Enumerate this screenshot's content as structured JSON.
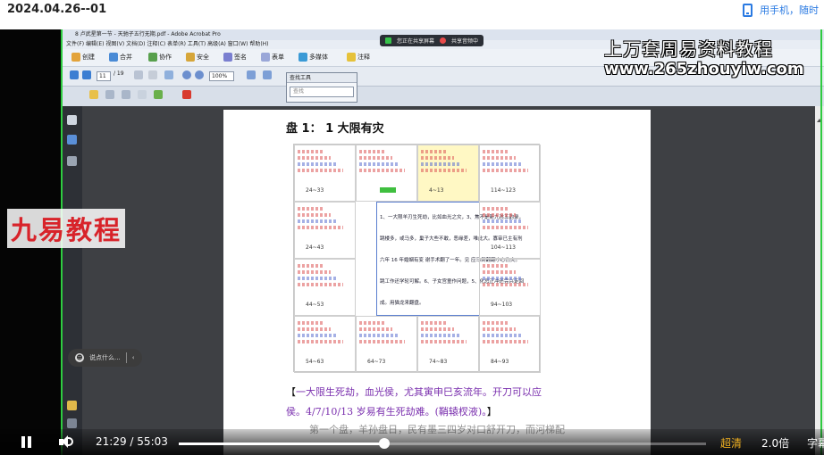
{
  "header": {
    "date": "2024.04.26--01",
    "mobile_text": "用手机，随时"
  },
  "acrobat": {
    "title": "8 卢武星第一节 - 天驰子五行无期.pdf - Adobe Acrobat Pro",
    "menu": "文件(F)  编辑(E)  视图(V)  文档(D)  注释(C)  表单(R)  工具(T)  高级(A)  窗口(W)  帮助(H)",
    "toolbar": {
      "create": "创建",
      "combine": "合并",
      "collaborate": "协作",
      "secure": "安全",
      "sign": "签名",
      "forms": "表单",
      "multimedia": "多媒体",
      "comment": "注释",
      "page_current": "11",
      "page_total": "/ 19",
      "zoom": "100%"
    },
    "share": {
      "active": "您正在共享屏幕",
      "sharing": "共享音频中"
    },
    "find": {
      "title": "查找工具",
      "placeholder": "查找"
    }
  },
  "watermark": {
    "title": "上万套周易资料教程",
    "url": "www.265zhouyiw.com",
    "brand": "九易教程"
  },
  "document": {
    "heading": "盘 1：  1 大限有灾",
    "ranges": [
      "24~33",
      "",
      "4~13",
      "114~123",
      "24~43",
      "",
      "",
      "104~113",
      "44~53",
      "",
      "",
      "94~103",
      "54~63",
      "64~73",
      "74~83",
      "84~93"
    ],
    "center_lines": [
      "1、一大限羊刃生死劫，比如血光之灾，3、焦不是新九孩五韵录，",
      "跳楼多，或马多，巢子大些不敢，恶缘差，唯此大。寡审已主有刑",
      "六年 16 年婚姻有变 谢手术翻了一年。见 应马倒翻翻小心伤灾。",
      "跳工作还学轮可解。6、子女宫童作问题，5、化忌正冲还完兴走回",
      "成。用猫龙来翻盘。"
    ],
    "caption_open": "【",
    "caption_body": "一大限生死劫，血光侯，尤其寅申巳亥流年。开刀可以应",
    "caption_line2": "侯。4/7/10/13 岁易有生死劫难。(鞘辕杈液)。",
    "caption_close": "】",
    "caption_faded": "第一个盘，羊孙盘日，民有墨三四岁对口舒开刀，而河梯配"
  },
  "danmaku": {
    "placeholder": "说点什么..."
  },
  "player": {
    "current": "21:29",
    "separator": "/",
    "duration": "55:03",
    "progress": 0.39,
    "quality": "超清",
    "speed": "2.0倍",
    "subtitle": "字幕"
  }
}
